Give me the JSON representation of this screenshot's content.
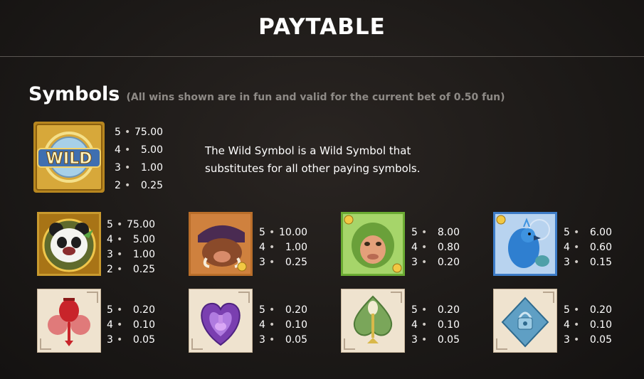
{
  "header": {
    "title": "PAYTABLE"
  },
  "symbols_section": {
    "title": "Symbols",
    "note": "(All wins shown are in fun and valid for the current bet of 0.50 fun)"
  },
  "wild": {
    "image_text": "WILD",
    "icon": "wild-icon",
    "pays": [
      {
        "count": "5",
        "value": "75.00"
      },
      {
        "count": "4",
        "value": "5.00"
      },
      {
        "count": "3",
        "value": "1.00"
      },
      {
        "count": "2",
        "value": "0.25"
      }
    ],
    "description": "The Wild Symbol is a Wild Symbol that substitutes for all other paying symbols."
  },
  "high_symbols": [
    {
      "icon": "panda-icon",
      "pays": [
        {
          "count": "5",
          "value": "75.00"
        },
        {
          "count": "4",
          "value": "5.00"
        },
        {
          "count": "3",
          "value": "1.00"
        },
        {
          "count": "2",
          "value": "0.25"
        }
      ]
    },
    {
      "icon": "boar-icon",
      "pays": [
        {
          "count": "5",
          "value": "10.00"
        },
        {
          "count": "4",
          "value": "1.00"
        },
        {
          "count": "3",
          "value": "0.25"
        }
      ]
    },
    {
      "icon": "monkey-icon",
      "pays": [
        {
          "count": "5",
          "value": "8.00"
        },
        {
          "count": "4",
          "value": "0.80"
        },
        {
          "count": "3",
          "value": "0.20"
        }
      ]
    },
    {
      "icon": "peacock-icon",
      "pays": [
        {
          "count": "5",
          "value": "6.00"
        },
        {
          "count": "4",
          "value": "0.60"
        },
        {
          "count": "3",
          "value": "0.15"
        }
      ]
    }
  ],
  "low_symbols": [
    {
      "icon": "club-lantern-icon",
      "pays": [
        {
          "count": "5",
          "value": "0.20"
        },
        {
          "count": "4",
          "value": "0.10"
        },
        {
          "count": "3",
          "value": "0.05"
        }
      ]
    },
    {
      "icon": "heart-potion-icon",
      "pays": [
        {
          "count": "5",
          "value": "0.20"
        },
        {
          "count": "4",
          "value": "0.10"
        },
        {
          "count": "3",
          "value": "0.05"
        }
      ]
    },
    {
      "icon": "spade-leaf-icon",
      "pays": [
        {
          "count": "5",
          "value": "0.20"
        },
        {
          "count": "4",
          "value": "0.10"
        },
        {
          "count": "3",
          "value": "0.05"
        }
      ]
    },
    {
      "icon": "diamond-lock-icon",
      "pays": [
        {
          "count": "5",
          "value": "0.20"
        },
        {
          "count": "4",
          "value": "0.10"
        },
        {
          "count": "3",
          "value": "0.05"
        }
      ]
    }
  ]
}
